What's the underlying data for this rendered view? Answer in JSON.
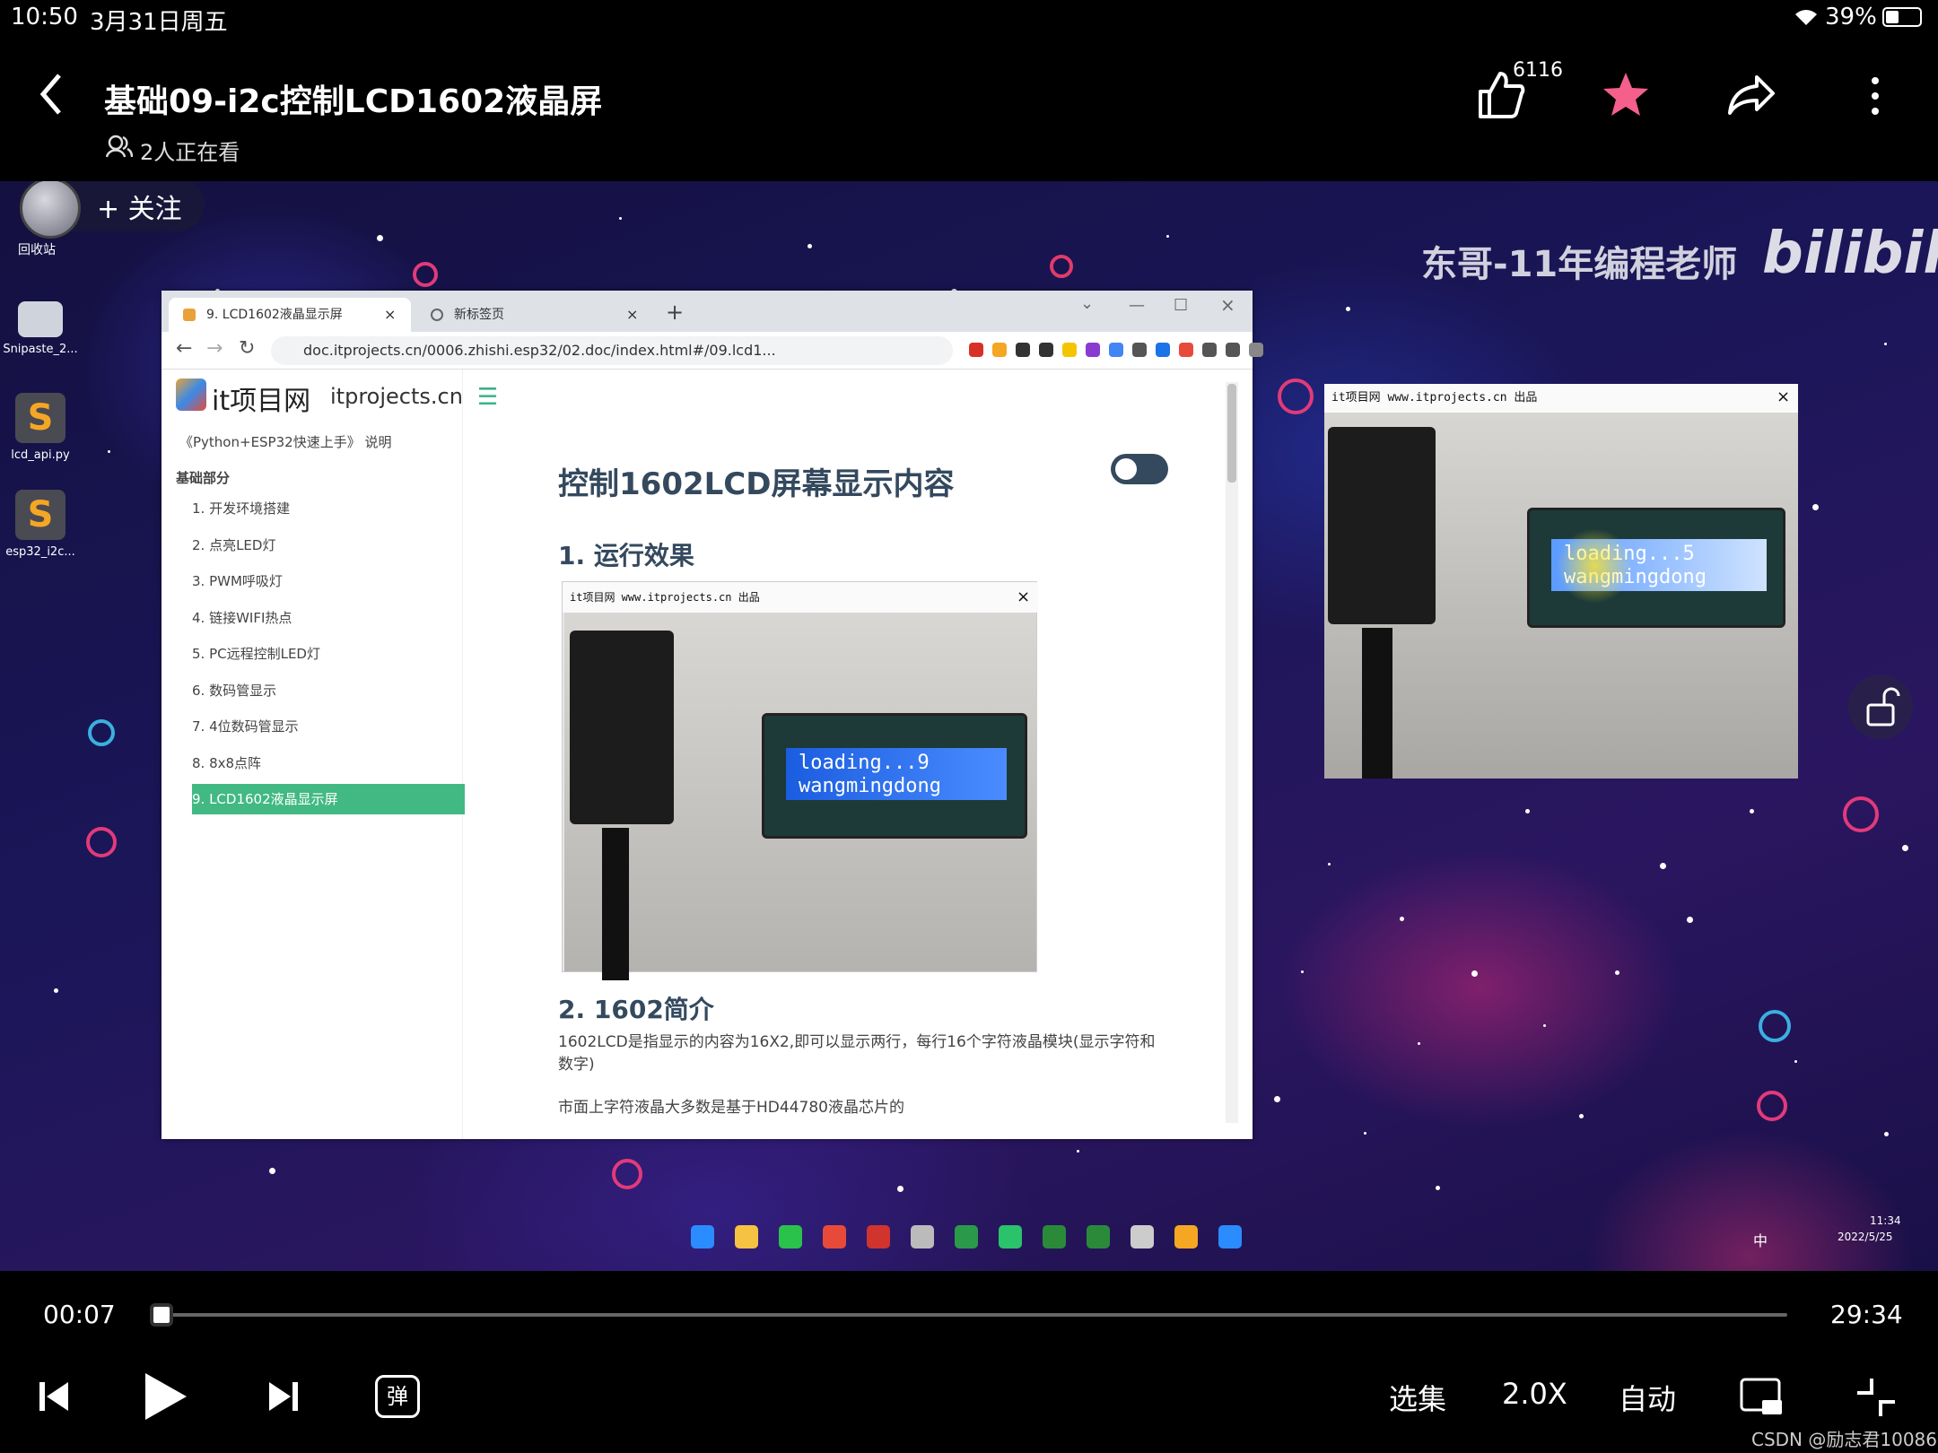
{
  "status_bar": {
    "time": "10:50",
    "date": "3月31日周五",
    "battery": "39%"
  },
  "header": {
    "title": "基础09-i2c控制LCD1602液晶屏",
    "viewers": "2人正在看",
    "like_count": "6116"
  },
  "overlay": {
    "follow": "+ 关注",
    "recycle_label": "回收站",
    "watermark": "东哥-11年编程老师",
    "brand": "bilibili"
  },
  "desktop_icons": [
    "Snipaste_2...",
    "lcd_api.py",
    "esp32_i2c..."
  ],
  "browser": {
    "tabs": [
      "9. LCD1602液晶显示屏",
      "新标签页"
    ],
    "url": "doc.itprojects.cn/0006.zhishi.esp32/02.doc/index.html#/09.lcd1...",
    "site_name": "it项目网",
    "site_domain": "itprojects.cn",
    "book_title": "《Python+ESP32快速上手》 说明",
    "section": "基础部分",
    "nav": [
      "1. 开发环境搭建",
      "2. 点亮LED灯",
      "3. PWM呼吸灯",
      "4. 链接WIFI热点",
      "5. PC远程控制LED灯",
      "6. 数码管显示",
      "7. 4位数码管显示",
      "8. 8x8点阵",
      "9. LCD1602液晶显示屏"
    ],
    "page_title": "控制1602LCD屏幕显示内容",
    "h_run": "1. 运行效果",
    "embed_title": "it项目网 www.itprojects.cn 出品",
    "lcd_lines": [
      "loading...9",
      "wangmingdong"
    ],
    "h_intro": "2. 1602简介",
    "p1": "1602LCD是指显示的内容为16X2,即可以显示两行，每行16个字符液晶模块(显示字符和数字)",
    "p2": "市面上字符液晶大多数是基于HD44780液晶芯片的"
  },
  "float_window": {
    "title": "it项目网 www.itprojects.cn 出品",
    "lcd_lines": [
      "loading...5",
      "wangmingdong"
    ]
  },
  "taskbar": {
    "time": "11:34",
    "date": "2022/5/25",
    "ime": "中"
  },
  "player": {
    "current": "00:07",
    "duration": "29:34",
    "episodes": "选集",
    "speed": "2.0X",
    "quality": "自动",
    "progress": 0.004
  },
  "footer_watermark": "CSDN @励志君10086"
}
